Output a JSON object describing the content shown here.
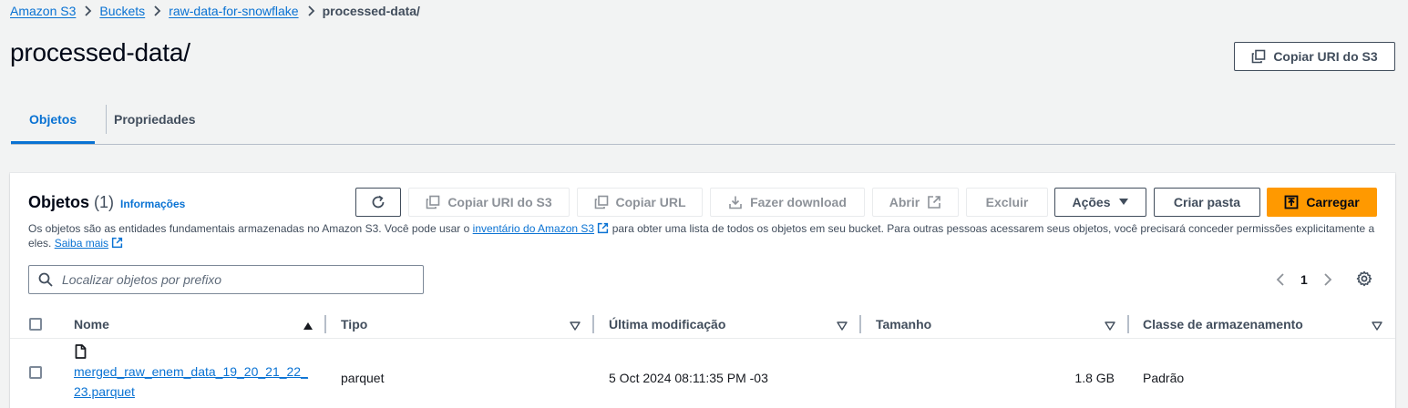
{
  "breadcrumb": {
    "items": [
      "Amazon S3",
      "Buckets",
      "raw-data-for-snowflake"
    ],
    "current": "processed-data/"
  },
  "page": {
    "title": "processed-data/",
    "copy_uri_label": "Copiar URI do S3"
  },
  "tabs": [
    {
      "label": "Objetos",
      "active": true
    },
    {
      "label": "Propriedades",
      "active": false
    }
  ],
  "objects_panel": {
    "title": "Objetos",
    "count": "(1)",
    "info_label": "Informações",
    "description_part1": "Os objetos são as entidades fundamentais armazenadas no Amazon S3. Você pode usar o ",
    "inventory_link": "inventário do Amazon S3",
    "description_part2": " para obter uma lista de todos os objetos em seu bucket. Para outras pessoas acessarem seus objetos, você precisará conceder permissões explicitamente a eles. ",
    "learn_more": "Saiba mais",
    "toolbar": {
      "refresh_icon": "refresh-icon",
      "copy_uri": "Copiar URI do S3",
      "copy_url": "Copiar URL",
      "download": "Fazer download",
      "open": "Abrir",
      "delete": "Excluir",
      "actions": "Ações",
      "create_folder": "Criar pasta",
      "upload": "Carregar"
    },
    "search_placeholder": "Localizar objetos por prefixo",
    "pagination": {
      "page": "1"
    },
    "table": {
      "columns": [
        "Nome",
        "Tipo",
        "Última modificação",
        "Tamanho",
        "Classe de armazenamento"
      ],
      "rows": [
        {
          "name_line1": "merged_raw_enem_data_19_20_21_22_",
          "name_line2": "23.parquet",
          "type": "parquet",
          "modified": "5 Oct 2024 08:11:35 PM -03",
          "size": "1.8 GB",
          "storage_class": "Padrão"
        }
      ]
    }
  },
  "colors": {
    "accent": "#0972d3",
    "primary_button": "#ff9900",
    "background": "#f2f3f3"
  }
}
